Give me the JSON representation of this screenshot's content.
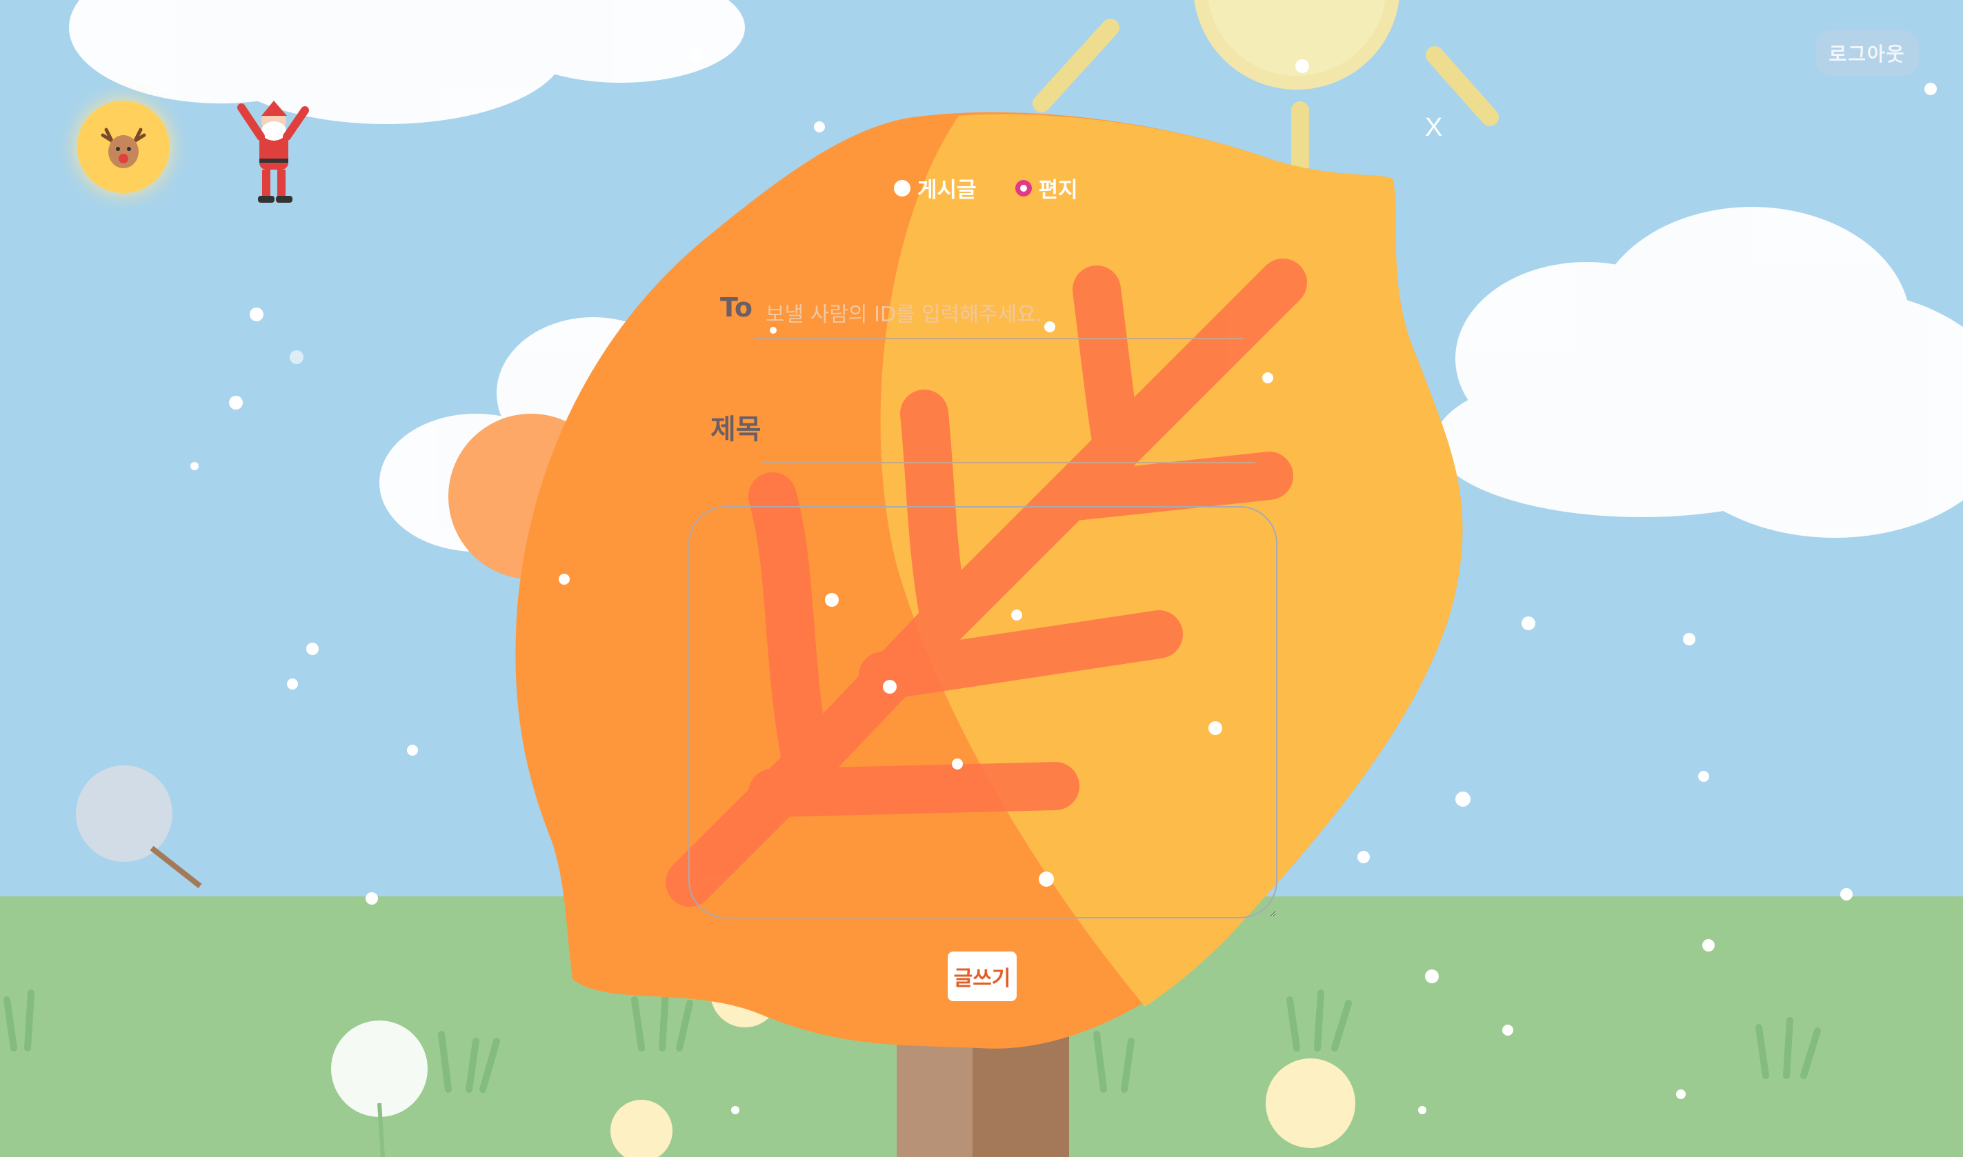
{
  "header": {
    "logout_label": "로그아웃"
  },
  "avatar_icon": "reindeer-icon",
  "mascot_icon": "santa-icon",
  "dialog": {
    "close_label": "X",
    "post_types": [
      {
        "label": "게시글",
        "selected": false
      },
      {
        "label": "편지",
        "selected": true
      }
    ],
    "to": {
      "label": "To",
      "placeholder": "보낼 사람의 ID를 입력해주세요.",
      "value": ""
    },
    "title": {
      "label": "제목",
      "value": ""
    },
    "body": {
      "value": ""
    },
    "submit_label": "글쓰기"
  },
  "colors": {
    "sky": "#a8d3ec",
    "grass": "#9ccb92",
    "leaf_orange": "#fe973c",
    "leaf_yellow": "#fdbb4a",
    "branch": "#ff7448",
    "accent_pink": "#e03a86",
    "submit_text": "#e35d25"
  }
}
